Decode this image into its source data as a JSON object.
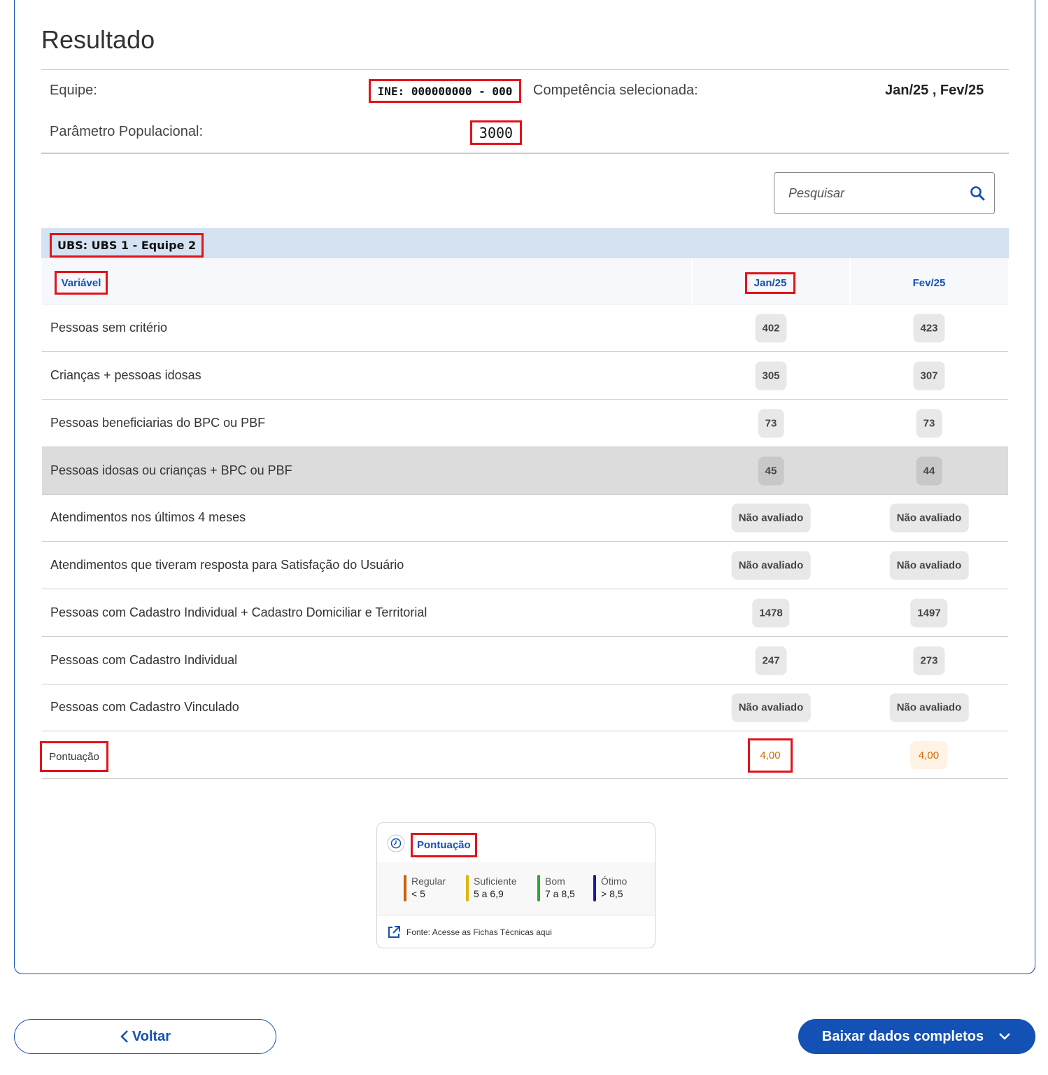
{
  "title": "Resultado",
  "info": {
    "team_label": "Equipe:",
    "team_value": "INE: 000000000 - 000",
    "competence_label": "Competência selecionada:",
    "competence_value": "Jan/25 , Fev/25",
    "population_label": "Parâmetro Populacional:",
    "population_value": "3000"
  },
  "search": {
    "placeholder": "Pesquisar"
  },
  "ubs_label": "UBS: UBS 1 - Equipe 2",
  "table": {
    "headers": {
      "variable": "Variável",
      "col1": "Jan/25",
      "col2": "Fev/25"
    },
    "rows": [
      {
        "label": "Pessoas sem critério",
        "v1": "402",
        "v2": "423"
      },
      {
        "label": "Crianças + pessoas idosas",
        "v1": "305",
        "v2": "307"
      },
      {
        "label": "Pessoas beneficiarias do BPC ou PBF",
        "v1": "73",
        "v2": "73"
      },
      {
        "label": "Pessoas idosas ou crianças + BPC ou PBF",
        "v1": "45",
        "v2": "44"
      },
      {
        "label": "Atendimentos nos últimos 4 meses",
        "v1": "Não avaliado",
        "v2": "Não avaliado"
      },
      {
        "label": "Atendimentos que tiveram resposta para Satisfação do Usuário",
        "v1": "Não avaliado",
        "v2": "Não avaliado"
      },
      {
        "label": "Pessoas com Cadastro Individual + Cadastro Domiciliar e Territorial",
        "v1": "1478",
        "v2": "1497"
      },
      {
        "label": "Pessoas com Cadastro Individual",
        "v1": "247",
        "v2": "273"
      },
      {
        "label": "Pessoas com Cadastro Vinculado",
        "v1": "Não avaliado",
        "v2": "Não avaliado"
      }
    ],
    "score": {
      "label": "Pontuação",
      "v1": "4,00",
      "v2": "4,00"
    }
  },
  "legend": {
    "title": "Pontuação",
    "items": [
      {
        "name": "Regular",
        "range": "< 5",
        "color": "#c8620c"
      },
      {
        "name": "Suficiente",
        "range": "5 a 6,9",
        "color": "#e0b400"
      },
      {
        "name": "Bom",
        "range": "7 a 8,5",
        "color": "#2ea82e"
      },
      {
        "name": "Ótimo",
        "range": "> 8,5",
        "color": "#1a1aa8"
      }
    ],
    "source": "Fonte: Acesse as Fichas Técnicas aqui"
  },
  "buttons": {
    "back": "Voltar",
    "download": "Baixar dados completos"
  },
  "colors": {
    "primary": "#1351b4",
    "annotation": "#e2131b",
    "score": "#d46a00"
  }
}
